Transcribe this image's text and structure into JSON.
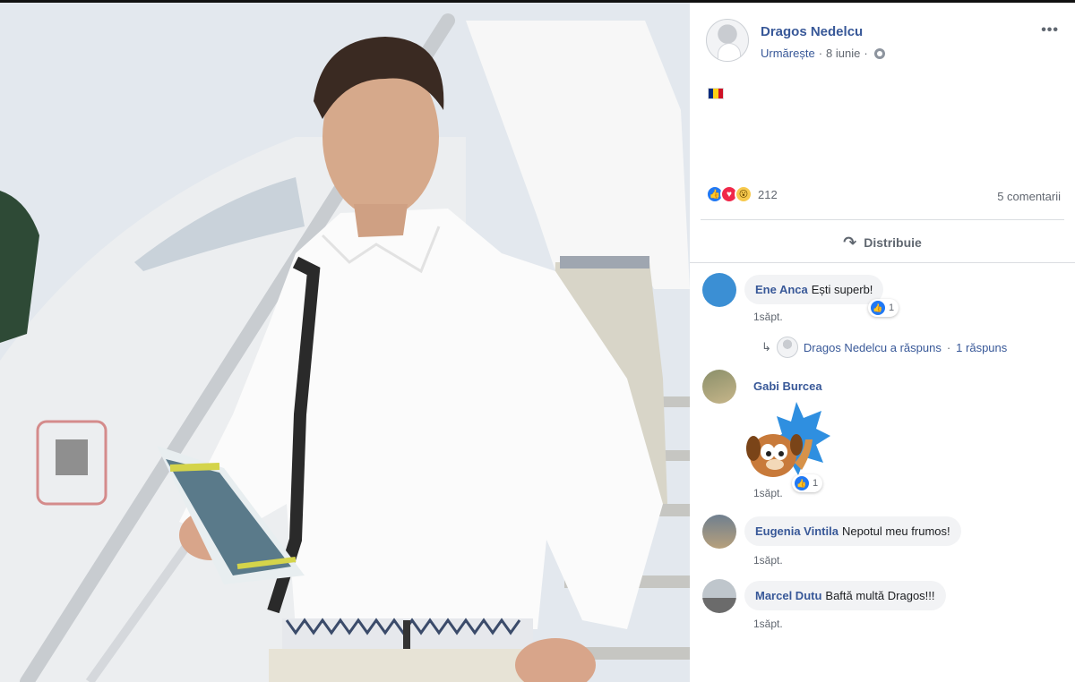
{
  "post": {
    "author": "Dragos Nedelcu",
    "follow_label": "Urmărește",
    "date": "8 iunie",
    "more_label": "•••",
    "flag_colors": [
      "#002b7f",
      "#fcd116",
      "#ce1126"
    ],
    "reactions": {
      "types": [
        "like",
        "love",
        "wow"
      ],
      "icons": [
        "👍",
        "♥",
        "😮"
      ],
      "count": "212"
    },
    "comments_count": "5 comentarii",
    "share_label": "Distribuie",
    "share_icon": "↷"
  },
  "comments": [
    {
      "name": "Ene Anca",
      "text": "Ești superb!",
      "time": "1săpt.",
      "likes": "1"
    },
    {
      "name": "Gabi Burcea",
      "text": "",
      "time": "1săpt.",
      "likes": "1"
    },
    {
      "name": "Eugenia Vintila",
      "text": "Nepotul meu frumos!",
      "time": "1săpt."
    },
    {
      "name": "Marcel Dutu",
      "text": "Baftă multă Dragos!!!",
      "time": "1săpt."
    }
  ],
  "reply": {
    "arrow": "↳",
    "text": "Dragos Nedelcu a răspuns",
    "separator": "·",
    "count": "1 răspuns"
  },
  "colors": {
    "link_blue": "#385898",
    "like_blue": "#2078f4",
    "love_red": "#f0284a",
    "wow_yellow": "#f7c94d",
    "bubble_gray": "#f2f3f5"
  }
}
